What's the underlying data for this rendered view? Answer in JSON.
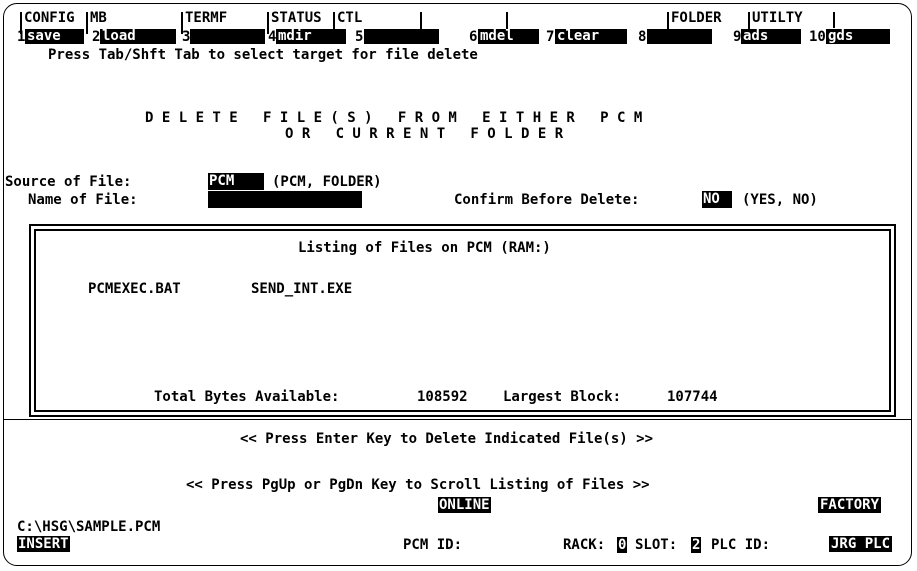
{
  "menu": {
    "headers": [
      "CONFIG",
      "MB",
      "TERMF",
      "STATUS",
      "CTL",
      "",
      "",
      "FOLDER",
      "UTILTY"
    ],
    "fkeys": [
      {
        "num": "1",
        "label": "save"
      },
      {
        "num": "2",
        "label": "load"
      },
      {
        "num": "3",
        "label": ""
      },
      {
        "num": "4",
        "label": "mdir"
      },
      {
        "num": "5",
        "label": ""
      },
      {
        "num": "6",
        "label": "mdel"
      },
      {
        "num": "7",
        "label": "clear"
      },
      {
        "num": "8",
        "label": ""
      },
      {
        "num": "9",
        "label": "ads"
      },
      {
        "num": "10",
        "label": "gds"
      }
    ],
    "hint": "Press Tab/Shft Tab to select target for file delete"
  },
  "title": {
    "line1": "D E L E T E   F I L E ( S )   F R O M   E I T H E R   P C M",
    "line2": "O R   C U R R E N T   F O L D E R"
  },
  "form": {
    "source_label": "Source of File:",
    "source_value": "PCM",
    "source_options": "(PCM, FOLDER)",
    "name_label": "Name of File:",
    "name_value": "",
    "confirm_label": "Confirm Before Delete:",
    "confirm_value": "NO",
    "confirm_options": "(YES, NO)"
  },
  "listing": {
    "title": "Listing of Files on PCM (RAM:)",
    "files": [
      "PCMEXEC.BAT",
      "SEND_INT.EXE"
    ],
    "bytes_label": "Total Bytes Available:",
    "bytes_value": "108592",
    "block_label": "Largest Block:",
    "block_value": "107744"
  },
  "prompts": {
    "enter": "<< Press Enter Key to Delete Indicated File(s) >>",
    "scroll": "<< Press PgUp or PgDn Key to Scroll Listing of Files >>"
  },
  "status": {
    "online": "ONLINE",
    "factory": "FACTORY",
    "path": "C:\\HSG\\SAMPLE.PCM",
    "insert": "INSERT",
    "pcm_id_label": "PCM ID:",
    "rack_label": "RACK:",
    "rack_value": "0",
    "slot_label": "SLOT:",
    "slot_value": "2",
    "plc_id_label": "PLC ID:",
    "plc_id_value": "JRG PLC"
  }
}
